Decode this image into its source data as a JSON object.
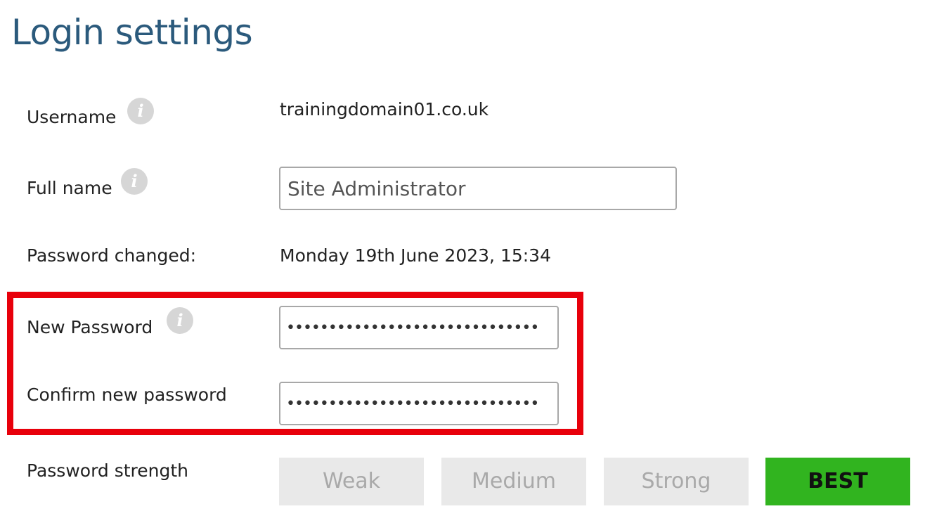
{
  "page": {
    "title": "Login settings"
  },
  "username": {
    "label": "Username",
    "value": "trainingdomain01.co.uk",
    "info_icon": "info-icon"
  },
  "full_name": {
    "label": "Full name",
    "value": "Site Administrator",
    "info_icon": "info-icon"
  },
  "password_changed": {
    "label": "Password changed:",
    "value": "Monday 19th June 2023, 15:34"
  },
  "new_password": {
    "label": "New Password",
    "value": "••••••••••••••••••••••••••••••",
    "info_icon": "info-icon"
  },
  "confirm_password": {
    "label": "Confirm new password",
    "value": "••••••••••••••••••••••••••••••"
  },
  "password_strength": {
    "label": "Password strength",
    "levels": [
      "Weak",
      "Medium",
      "Strong",
      "BEST"
    ],
    "active_level": "BEST"
  },
  "colors": {
    "title": "#2b5a7c",
    "highlight": "#e8000b",
    "strength_active": "#31b41f",
    "strength_inactive": "#e9e9e9"
  }
}
